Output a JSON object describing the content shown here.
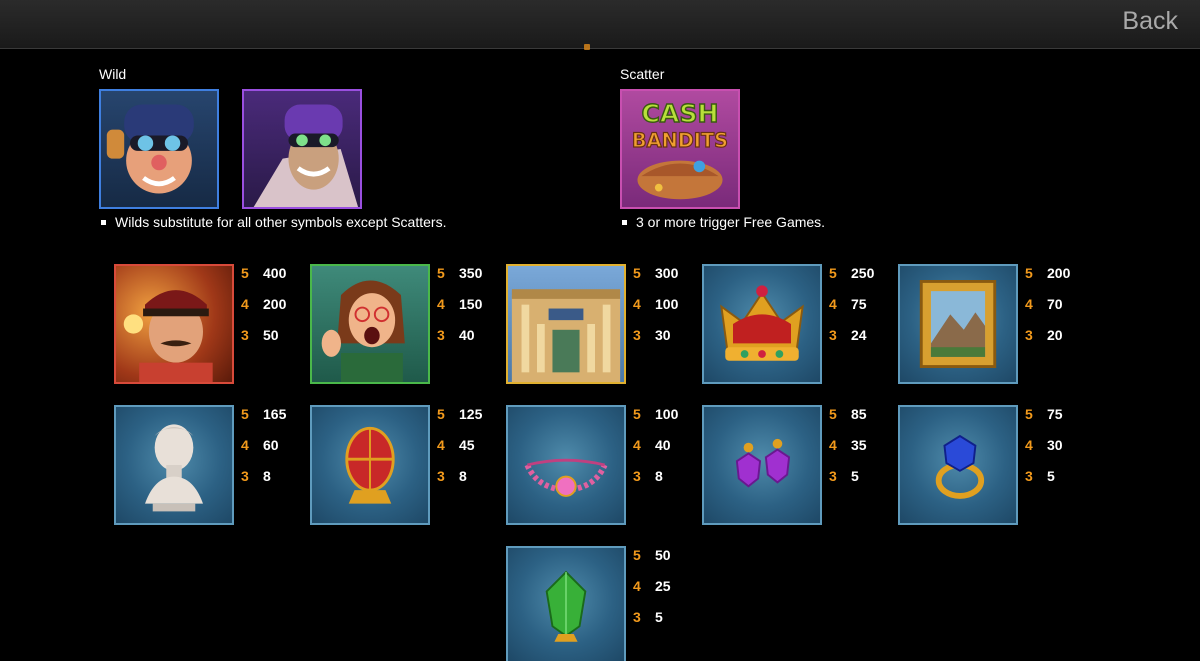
{
  "header": {
    "back_label": "Back"
  },
  "wild": {
    "label": "Wild",
    "note": "Wilds substitute for all other symbols except Scatters.",
    "icons": [
      "bandit-wild-blue-icon",
      "bandit-wild-purple-icon"
    ]
  },
  "scatter": {
    "label": "Scatter",
    "note": "3 or more trigger Free Games.",
    "logo_line1": "CASH",
    "logo_line2": "BANDITS"
  },
  "symbols": [
    {
      "icon": "guard-icon",
      "pays": [
        {
          "n": "5",
          "v": "400"
        },
        {
          "n": "4",
          "v": "200"
        },
        {
          "n": "3",
          "v": "50"
        }
      ]
    },
    {
      "icon": "screaming-woman-icon",
      "pays": [
        {
          "n": "5",
          "v": "350"
        },
        {
          "n": "4",
          "v": "150"
        },
        {
          "n": "3",
          "v": "40"
        }
      ]
    },
    {
      "icon": "museum-icon",
      "pays": [
        {
          "n": "5",
          "v": "300"
        },
        {
          "n": "4",
          "v": "100"
        },
        {
          "n": "3",
          "v": "30"
        }
      ]
    },
    {
      "icon": "crown-icon",
      "pays": [
        {
          "n": "5",
          "v": "250"
        },
        {
          "n": "4",
          "v": "75"
        },
        {
          "n": "3",
          "v": "24"
        }
      ]
    },
    {
      "icon": "painting-icon",
      "pays": [
        {
          "n": "5",
          "v": "200"
        },
        {
          "n": "4",
          "v": "70"
        },
        {
          "n": "3",
          "v": "20"
        }
      ]
    },
    {
      "icon": "bust-icon",
      "pays": [
        {
          "n": "5",
          "v": "165"
        },
        {
          "n": "4",
          "v": "60"
        },
        {
          "n": "3",
          "v": "8"
        }
      ]
    },
    {
      "icon": "jeweled-egg-icon",
      "pays": [
        {
          "n": "5",
          "v": "125"
        },
        {
          "n": "4",
          "v": "45"
        },
        {
          "n": "3",
          "v": "8"
        }
      ]
    },
    {
      "icon": "necklace-icon",
      "pays": [
        {
          "n": "5",
          "v": "100"
        },
        {
          "n": "4",
          "v": "40"
        },
        {
          "n": "3",
          "v": "8"
        }
      ]
    },
    {
      "icon": "earrings-icon",
      "pays": [
        {
          "n": "5",
          "v": "85"
        },
        {
          "n": "4",
          "v": "35"
        },
        {
          "n": "3",
          "v": "5"
        }
      ]
    },
    {
      "icon": "sapphire-ring-icon",
      "pays": [
        {
          "n": "5",
          "v": "75"
        },
        {
          "n": "4",
          "v": "30"
        },
        {
          "n": "3",
          "v": "5"
        }
      ]
    },
    {
      "icon": "emerald-icon",
      "pays": [
        {
          "n": "5",
          "v": "50"
        },
        {
          "n": "4",
          "v": "25"
        },
        {
          "n": "3",
          "v": "5"
        }
      ]
    }
  ],
  "colors": {
    "pay_count": "#f29a1c",
    "pay_value": "#ffffff",
    "background": "#000000"
  }
}
